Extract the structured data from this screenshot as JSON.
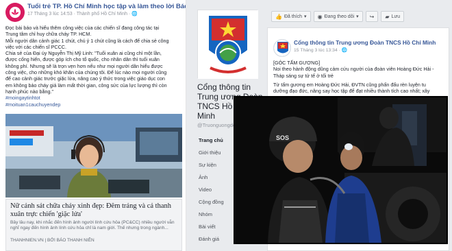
{
  "left_post": {
    "page_name": "Tuổi trẻ TP. Hồ Chí Minh học tập và làm theo lời Bác",
    "meta": "17 Tháng 3 lúc 14:53 · Thành phố Hồ Chí Minh · ",
    "body_lines": [
      "Đọc bài báo và hiểu thêm công việc của các chiến sĩ đang công tác tại",
      "Trung tâm chỉ huy chữa cháy TP. HCM.",
      "Mỗi người dân cảnh giác 1 chút, chú ý 1 chút cũng là cách để chia sẻ công",
      "việc với các chiến sĩ PCCC.",
      "Chia sẻ của Đại úy Nguyễn Thị Mỹ Linh: \"Tuổi xuân ai cũng chỉ một lần,",
      "được cống hiến, được góp ích cho tổ quốc, cho nhân dân thì tuổi xuân",
      "không phí. Nhưng sẽ là trọn vẹn hơn nếu như mọi người dân hiểu được",
      "công việc, cho những khó khăn của chúng tôi. Để lúc nào mọi người cũng",
      "để cao cảnh giác trước giặc lửa, nâng cao ý thức trong việc giáo dục con",
      "em không bảo cháy giả làm mất thời gian, công sức của lực lượng thì còn",
      "hạnh phúc nào bằng.\""
    ],
    "hashtags": [
      "#moingaytinhtot",
      "#moituan1cauchuyendep"
    ],
    "link": {
      "title": "Nữ cảnh sát chữa cháy xinh đẹp: Đêm tráng và cả thanh xuân trực chiến 'giặc lửa'",
      "description": "Bây lâu nay, khi nhắc đến hình ảnh người lính cứu hỏa (PC&CC) nhiều người vẫn nghĩ ngay đến hình ảnh lính cứu hỏa chỉ là nam giới. Thế nhưng trong ngành...",
      "source": "THANHNIEN.VN | BỞI BÁO THANH NIÊN"
    }
  },
  "right_page": {
    "title": "Cổng thông tin Trung ương Đoàn TNCS Hồ Chí Minh",
    "handle": "@Truonguongdoan",
    "nav": [
      "Trang chủ",
      "Giới thiệu",
      "Sự kiện",
      "Ảnh",
      "Video",
      "Cộng đồng",
      "Nhóm",
      "Bài viết",
      "Đánh giá"
    ],
    "actions": [
      {
        "icon": "thumbs-up-icon",
        "label": "Đã thích",
        "caret": "▾"
      },
      {
        "icon": "rss-icon",
        "label": "Đang theo dõi",
        "caret": "▾"
      },
      {
        "icon": "share-icon",
        "label": "",
        "caret": ""
      },
      {
        "icon": "bookmark-icon",
        "label": "Lưu",
        "caret": ""
      }
    ],
    "post": {
      "page_name": "Cổng thông tin Trung ương Đoàn TNCS Hồ Chí Minh",
      "meta": "15 Tháng 3 lúc 13:34 · ",
      "body_lines": [
        "[GÓC TẤM GƯƠNG]",
        "Noi theo hành động dũng cảm cứu người của đoàn viên Hoàng Đức Hải -",
        "Tháp sáng sự tử tế ở tối trẻ",
        "",
        "Từ tấm gương em Hoàng Đức Hải, ĐVTN cũng phấn đấu rèn luyện tu",
        "dưỡng đạo đức, nâng say học tập để đạt nhiều thành tích cao nhất; xây"
      ]
    }
  },
  "overlay_photo": {
    "helmet_text": "SOS"
  },
  "colors": {
    "facebook_blue": "#385898",
    "page_bg": "#e9ebee",
    "left_avatar": "#d81b60"
  }
}
